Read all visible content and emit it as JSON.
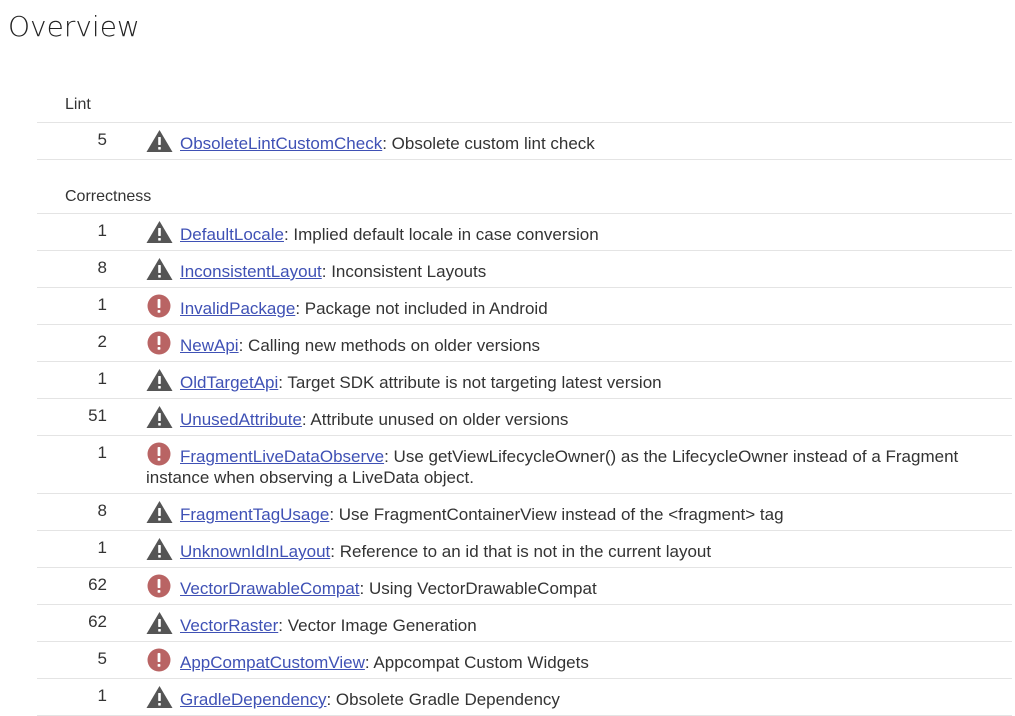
{
  "page": {
    "title": "Overview"
  },
  "icons": {
    "warning": {
      "name": "warning-icon",
      "color": "#555555"
    },
    "error": {
      "name": "error-icon",
      "color": "#b96464"
    }
  },
  "categories": [
    {
      "name": "Lint",
      "issues": [
        {
          "count": "5",
          "severity": "warning",
          "id": "ObsoleteLintCustomCheck",
          "summary": ": Obsolete custom lint check"
        }
      ]
    },
    {
      "name": "Correctness",
      "issues": [
        {
          "count": "1",
          "severity": "warning",
          "id": "DefaultLocale",
          "summary": ": Implied default locale in case conversion"
        },
        {
          "count": "8",
          "severity": "warning",
          "id": "InconsistentLayout",
          "summary": ": Inconsistent Layouts"
        },
        {
          "count": "1",
          "severity": "error",
          "id": "InvalidPackage",
          "summary": ": Package not included in Android"
        },
        {
          "count": "2",
          "severity": "error",
          "id": "NewApi",
          "summary": ": Calling new methods on older versions"
        },
        {
          "count": "1",
          "severity": "warning",
          "id": "OldTargetApi",
          "summary": ": Target SDK attribute is not targeting latest version"
        },
        {
          "count": "51",
          "severity": "warning",
          "id": "UnusedAttribute",
          "summary": ": Attribute unused on older versions"
        },
        {
          "count": "1",
          "severity": "error",
          "id": "FragmentLiveDataObserve",
          "summary": ": Use getViewLifecycleOwner() as the LifecycleOwner instead of a Fragment instance when observing a LiveData object."
        },
        {
          "count": "8",
          "severity": "warning",
          "id": "FragmentTagUsage",
          "summary": ": Use FragmentContainerView instead of the <fragment> tag"
        },
        {
          "count": "1",
          "severity": "warning",
          "id": "UnknownIdInLayout",
          "summary": ": Reference to an id that is not in the current layout"
        },
        {
          "count": "62",
          "severity": "error",
          "id": "VectorDrawableCompat",
          "summary": ": Using VectorDrawableCompat"
        },
        {
          "count": "62",
          "severity": "warning",
          "id": "VectorRaster",
          "summary": ": Vector Image Generation"
        },
        {
          "count": "5",
          "severity": "error",
          "id": "AppCompatCustomView",
          "summary": ": Appcompat Custom Widgets"
        },
        {
          "count": "1",
          "severity": "warning",
          "id": "GradleDependency",
          "summary": ": Obsolete Gradle Dependency"
        }
      ]
    }
  ]
}
